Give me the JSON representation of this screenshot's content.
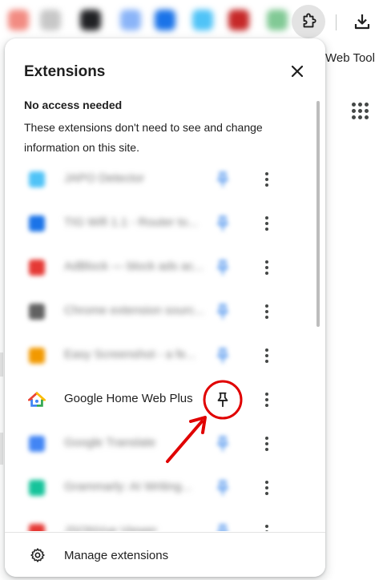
{
  "toolbar": {
    "blurred_icon_colors": [
      "#f28b82",
      "#c7c7c7",
      "#202124",
      "#8ab4f8",
      "#1a73e8",
      "#4fc3f7",
      "#c62828",
      "#81c995"
    ]
  },
  "background": {
    "partial_text": "Web Tool"
  },
  "popup": {
    "title": "Extensions",
    "section_title": "No access needed",
    "section_description": "These extensions don't need to see and change information on this site.",
    "extensions": [
      {
        "name": "JAPO Detector",
        "icon_color": "#4fc3f7",
        "blurred": true
      },
      {
        "name": "TIG Wifi 1.1 - Router to...",
        "icon_color": "#1a73e8",
        "blurred": true
      },
      {
        "name": "AdBlock — block ads ac...",
        "icon_color": "#e53935",
        "blurred": true
      },
      {
        "name": "Chrome extension sourc...",
        "icon_color": "#616161",
        "blurred": true
      },
      {
        "name": "Easy Screenshot - a fe...",
        "icon_color": "#f29900",
        "blurred": true
      },
      {
        "name": "Google Home Web Plus",
        "icon": "google-home-icon",
        "blurred": false
      },
      {
        "name": "Google Translate",
        "icon_color": "#4285f4",
        "blurred": true
      },
      {
        "name": "Grammarly: AI Writing...",
        "icon_color": "#15c39a",
        "blurred": true
      },
      {
        "name": "JSONVue Viewer",
        "icon_color": "#e53935",
        "blurred": true
      }
    ],
    "footer_label": "Manage extensions"
  },
  "annotation": {
    "color": "#e00000",
    "highlight": "pin-icon of Google Home Web Plus"
  }
}
